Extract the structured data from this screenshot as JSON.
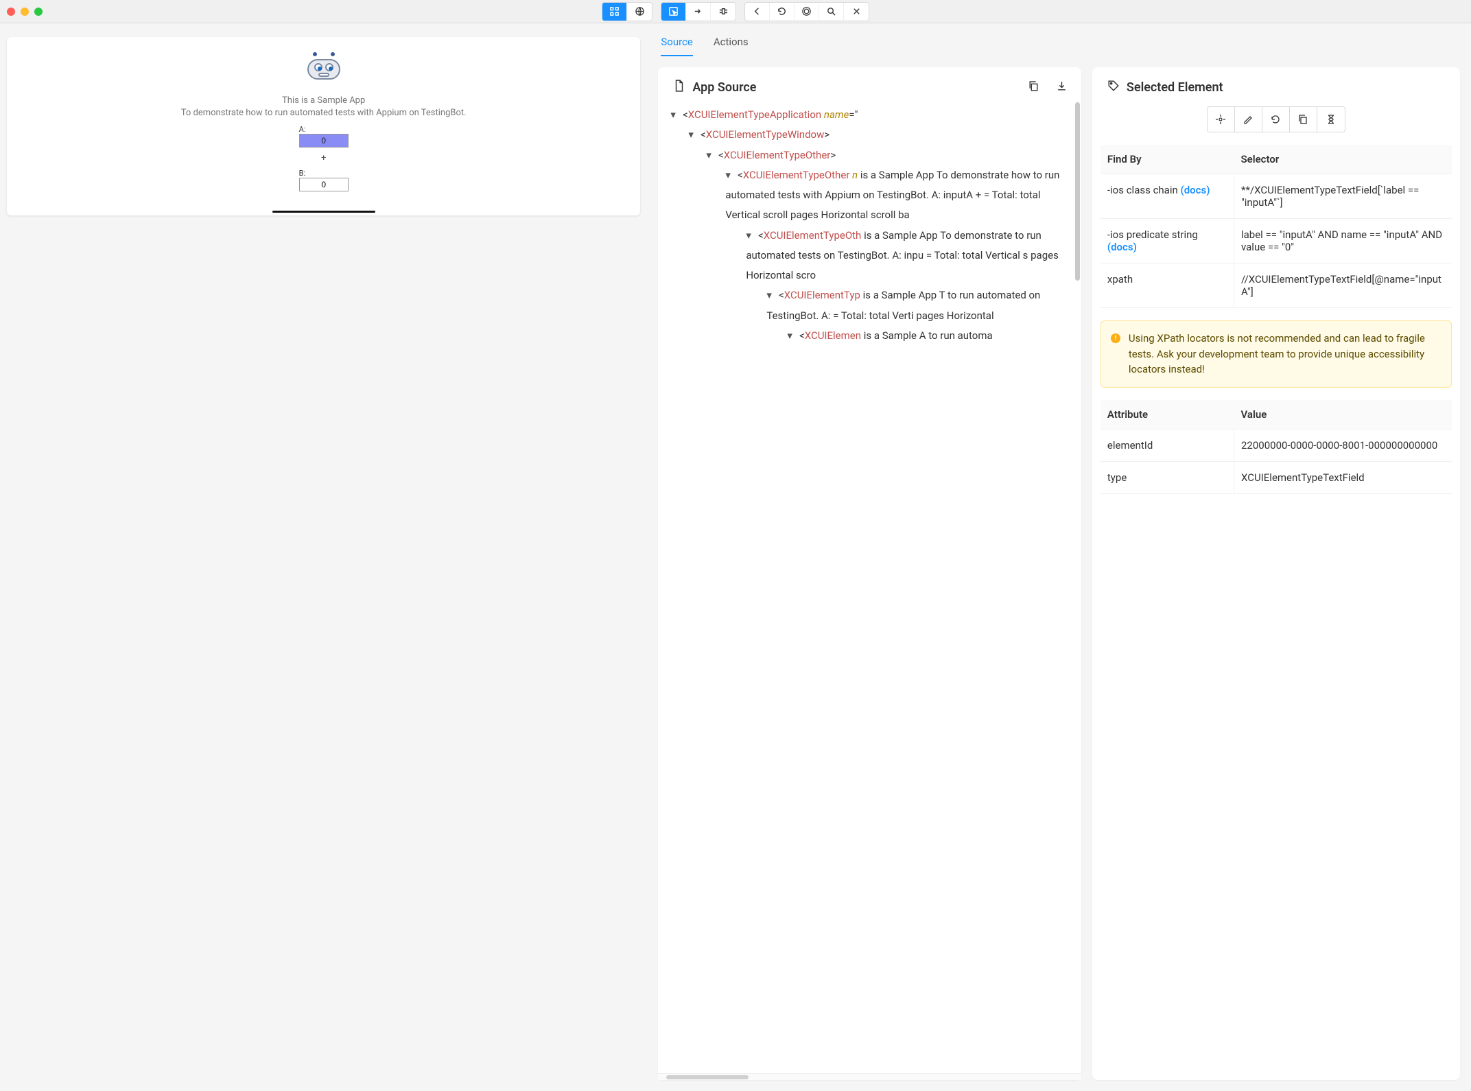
{
  "tabs": {
    "source": "Source",
    "actions": "Actions"
  },
  "appSource": {
    "title": "App Source"
  },
  "device": {
    "title_line1": "This is a Sample App",
    "title_line2": "To demonstrate how to run automated tests with Appium on TestingBot.",
    "labelA": "A:",
    "valueA": "0",
    "plus": "+",
    "labelB": "B:",
    "valueB": "0"
  },
  "tree": {
    "node0": {
      "tag": "XCUIElementTypeApplication",
      "attr": "name",
      "attrEq": "=\""
    },
    "node1": {
      "open": "<",
      "tag": "XCUIElementTypeWindow",
      "close": ">"
    },
    "node2": {
      "open": "<",
      "tag": "XCUIElementTypeOther",
      "close": ">"
    },
    "node3": {
      "open": "<",
      "tag": "XCUIElementTypeOther",
      "attr_prefix": " n",
      "text": "is a Sample App To demonstrate how to run automated tests with Appium on TestingBot. A: inputA + = Total: total Vertical scroll pages Horizontal scroll ba"
    },
    "node4": {
      "open": "<",
      "tag": "XCUIElementTypeOth",
      "text": "is a Sample App To demonstrate to run automated tests on TestingBot. A: inpu = Total: total Vertical s pages Horizontal scro"
    },
    "node5": {
      "open": "<",
      "tag": "XCUIElementTyp",
      "text": "is a Sample App T to run automated on TestingBot. A: = Total: total Verti pages Horizontal"
    },
    "node6": {
      "open": "<",
      "tag": "XCUIElemen",
      "text": "is a Sample A to run automa"
    }
  },
  "selected": {
    "title": "Selected Element",
    "table_headers": {
      "findby": "Find By",
      "selector": "Selector"
    },
    "rows": [
      {
        "findby": "-ios class chain",
        "docs": "(docs)",
        "selector": "**/XCUIElementTypeTextField[`label == \"inputA\"`]"
      },
      {
        "findby": "-ios predicate string",
        "docs": "(docs)",
        "selector": "label == \"inputA\" AND name == \"inputA\" AND value == \"0\""
      },
      {
        "findby": "xpath",
        "docs": "",
        "selector": "//XCUIElementTypeTextField[@name=\"inputA\"]"
      }
    ],
    "warning": "Using XPath locators is not recommended and can lead to fragile tests. Ask your development team to provide unique accessibility locators instead!",
    "attr_headers": {
      "attr": "Attribute",
      "val": "Value"
    },
    "attrs": [
      {
        "attr": "elementId",
        "val": "22000000-0000-0000-8001-000000000000"
      },
      {
        "attr": "type",
        "val": "XCUIElementTypeTextField"
      }
    ]
  }
}
